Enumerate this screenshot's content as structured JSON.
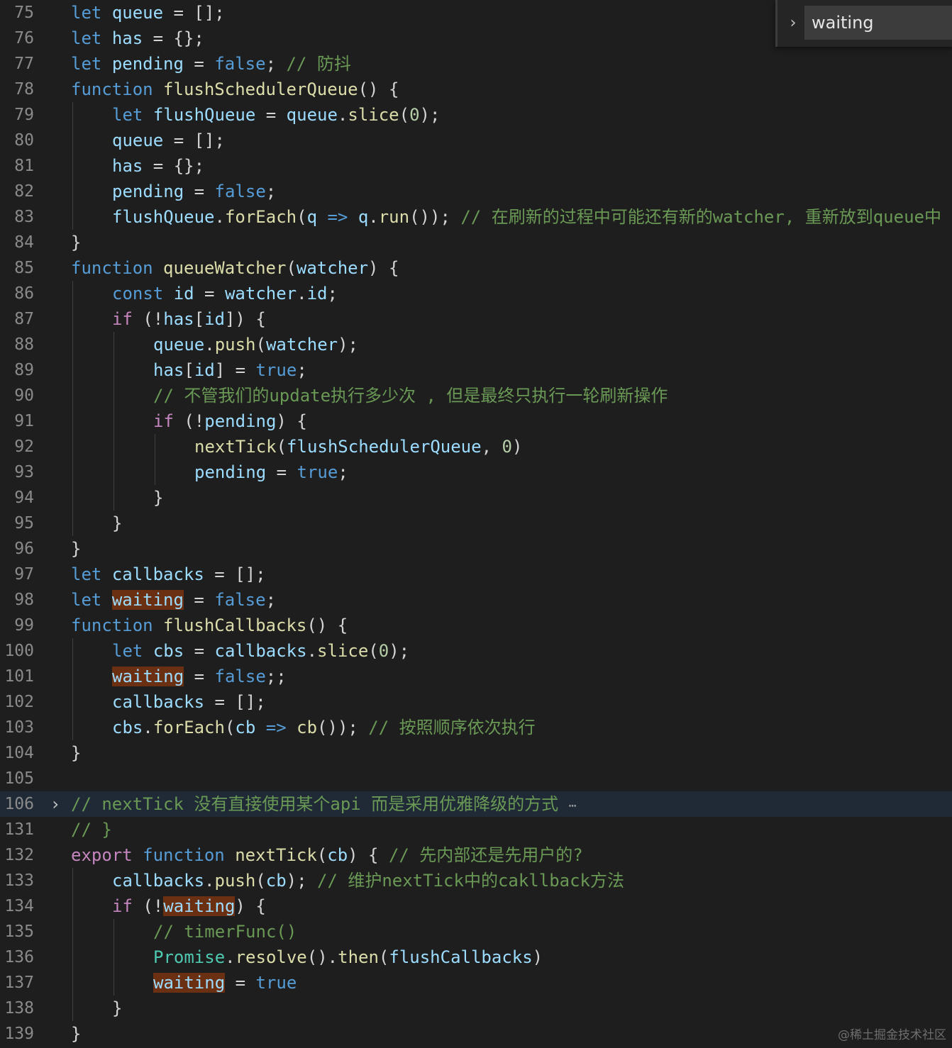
{
  "find_widget": {
    "query": "waiting",
    "toggle_icon": "chevron-right-icon"
  },
  "watermark": "@稀土掘金技术社区",
  "code_lines": [
    {
      "n": "75",
      "indent": 0,
      "tokens": [
        [
          "let",
          "kw"
        ],
        [
          " "
        ],
        [
          "queue",
          "var"
        ],
        [
          " = [];"
        ]
      ]
    },
    {
      "n": "76",
      "indent": 0,
      "tokens": [
        [
          "let",
          "kw"
        ],
        [
          " "
        ],
        [
          "has",
          "var"
        ],
        [
          " = {};"
        ]
      ]
    },
    {
      "n": "77",
      "indent": 0,
      "tokens": [
        [
          "let",
          "kw"
        ],
        [
          " "
        ],
        [
          "pending",
          "var"
        ],
        [
          " = "
        ],
        [
          "false",
          "bool"
        ],
        [
          "; "
        ],
        [
          "// 防抖",
          "cmt"
        ]
      ]
    },
    {
      "n": "78",
      "indent": 0,
      "tokens": [
        [
          "function",
          "kw"
        ],
        [
          " "
        ],
        [
          "flushSchedulerQueue",
          "fn"
        ],
        [
          "() {"
        ]
      ]
    },
    {
      "n": "79",
      "indent": 1,
      "tokens": [
        [
          "let",
          "kw"
        ],
        [
          " "
        ],
        [
          "flushQueue",
          "var"
        ],
        [
          " = "
        ],
        [
          "queue",
          "var"
        ],
        [
          "."
        ],
        [
          "slice",
          "fn"
        ],
        [
          "("
        ],
        [
          "0",
          "num"
        ],
        [
          ");"
        ]
      ]
    },
    {
      "n": "80",
      "indent": 1,
      "tokens": [
        [
          "queue",
          "var"
        ],
        [
          " = [];"
        ]
      ]
    },
    {
      "n": "81",
      "indent": 1,
      "tokens": [
        [
          "has",
          "var"
        ],
        [
          " = {};"
        ]
      ]
    },
    {
      "n": "82",
      "indent": 1,
      "tokens": [
        [
          "pending",
          "var"
        ],
        [
          " = "
        ],
        [
          "false",
          "bool"
        ],
        [
          ";"
        ]
      ]
    },
    {
      "n": "83",
      "indent": 1,
      "tokens": [
        [
          "flushQueue",
          "var"
        ],
        [
          "."
        ],
        [
          "forEach",
          "fn"
        ],
        [
          "("
        ],
        [
          "q",
          "var"
        ],
        [
          " "
        ],
        [
          "=>",
          "kw"
        ],
        [
          " "
        ],
        [
          "q",
          "var"
        ],
        [
          "."
        ],
        [
          "run",
          "fn"
        ],
        [
          "()); "
        ],
        [
          "// 在刷新的过程中可能还有新的watcher, 重新放到queue中",
          "cmt"
        ]
      ]
    },
    {
      "n": "84",
      "indent": 0,
      "tokens": [
        [
          "}"
        ]
      ]
    },
    {
      "n": "85",
      "indent": 0,
      "tokens": [
        [
          "function",
          "kw"
        ],
        [
          " "
        ],
        [
          "queueWatcher",
          "fn"
        ],
        [
          "("
        ],
        [
          "watcher",
          "var"
        ],
        [
          ") {"
        ]
      ]
    },
    {
      "n": "86",
      "indent": 1,
      "tokens": [
        [
          "const",
          "kw"
        ],
        [
          " "
        ],
        [
          "id",
          "var"
        ],
        [
          " = "
        ],
        [
          "watcher",
          "var"
        ],
        [
          "."
        ],
        [
          "id",
          "var"
        ],
        [
          ";"
        ]
      ]
    },
    {
      "n": "87",
      "indent": 1,
      "tokens": [
        [
          "if",
          "ctl"
        ],
        [
          " (!"
        ],
        [
          "has",
          "var"
        ],
        [
          "["
        ],
        [
          "id",
          "var"
        ],
        [
          "]) {"
        ]
      ]
    },
    {
      "n": "88",
      "indent": 2,
      "tokens": [
        [
          "queue",
          "var"
        ],
        [
          "."
        ],
        [
          "push",
          "fn"
        ],
        [
          "("
        ],
        [
          "watcher",
          "var"
        ],
        [
          ");"
        ]
      ]
    },
    {
      "n": "89",
      "indent": 2,
      "tokens": [
        [
          "has",
          "var"
        ],
        [
          "["
        ],
        [
          "id",
          "var"
        ],
        [
          "] = "
        ],
        [
          "true",
          "bool"
        ],
        [
          ";"
        ]
      ]
    },
    {
      "n": "90",
      "indent": 2,
      "tokens": [
        [
          "// 不管我们的update执行多少次 , 但是最终只执行一轮刷新操作",
          "cmt"
        ]
      ]
    },
    {
      "n": "91",
      "indent": 2,
      "tokens": [
        [
          "if",
          "ctl"
        ],
        [
          " (!"
        ],
        [
          "pending",
          "var"
        ],
        [
          ") {"
        ]
      ]
    },
    {
      "n": "92",
      "indent": 3,
      "tokens": [
        [
          "nextTick",
          "fn"
        ],
        [
          "("
        ],
        [
          "flushSchedulerQueue",
          "var"
        ],
        [
          ", "
        ],
        [
          "0",
          "num"
        ],
        [
          ")"
        ]
      ]
    },
    {
      "n": "93",
      "indent": 3,
      "tokens": [
        [
          "pending",
          "var"
        ],
        [
          " = "
        ],
        [
          "true",
          "bool"
        ],
        [
          ";"
        ]
      ]
    },
    {
      "n": "94",
      "indent": 2,
      "tokens": [
        [
          "}"
        ]
      ]
    },
    {
      "n": "95",
      "indent": 1,
      "tokens": [
        [
          "}"
        ]
      ]
    },
    {
      "n": "96",
      "indent": 0,
      "tokens": [
        [
          "}"
        ]
      ]
    },
    {
      "n": "97",
      "indent": 0,
      "tokens": [
        [
          "let",
          "kw"
        ],
        [
          " "
        ],
        [
          "callbacks",
          "var"
        ],
        [
          " = [];"
        ]
      ]
    },
    {
      "n": "98",
      "indent": 0,
      "tokens": [
        [
          "let",
          "kw"
        ],
        [
          " "
        ],
        [
          "waiting",
          "var hl"
        ],
        [
          " = "
        ],
        [
          "false",
          "bool"
        ],
        [
          ";"
        ]
      ]
    },
    {
      "n": "99",
      "indent": 0,
      "tokens": [
        [
          "function",
          "kw"
        ],
        [
          " "
        ],
        [
          "flushCallbacks",
          "fn"
        ],
        [
          "() {"
        ]
      ]
    },
    {
      "n": "100",
      "indent": 1,
      "tokens": [
        [
          "let",
          "kw"
        ],
        [
          " "
        ],
        [
          "cbs",
          "var"
        ],
        [
          " = "
        ],
        [
          "callbacks",
          "var"
        ],
        [
          "."
        ],
        [
          "slice",
          "fn"
        ],
        [
          "("
        ],
        [
          "0",
          "num"
        ],
        [
          ");"
        ]
      ]
    },
    {
      "n": "101",
      "indent": 1,
      "tokens": [
        [
          "waiting",
          "var hl"
        ],
        [
          " = "
        ],
        [
          "false",
          "bool"
        ],
        [
          ";;"
        ]
      ]
    },
    {
      "n": "102",
      "indent": 1,
      "tokens": [
        [
          "callbacks",
          "var"
        ],
        [
          " = [];"
        ]
      ]
    },
    {
      "n": "103",
      "indent": 1,
      "tokens": [
        [
          "cbs",
          "var"
        ],
        [
          "."
        ],
        [
          "forEach",
          "fn"
        ],
        [
          "("
        ],
        [
          "cb",
          "var"
        ],
        [
          " "
        ],
        [
          "=>",
          "kw"
        ],
        [
          " "
        ],
        [
          "cb",
          "fn"
        ],
        [
          "()); "
        ],
        [
          "// 按照顺序依次执行",
          "cmt"
        ]
      ]
    },
    {
      "n": "104",
      "indent": 0,
      "tokens": [
        [
          "}"
        ]
      ]
    },
    {
      "n": "105",
      "indent": 0,
      "tokens": []
    },
    {
      "n": "106",
      "indent": 0,
      "folded": true,
      "tokens": [
        [
          "// nextTick 没有直接使用某个api 而是采用优雅降级的方式 ",
          "cmt"
        ],
        [
          "⋯",
          "ell"
        ]
      ]
    },
    {
      "n": "131",
      "indent": 0,
      "tokens": [
        [
          "// }",
          "cmt"
        ]
      ]
    },
    {
      "n": "132",
      "indent": 0,
      "tokens": [
        [
          "export",
          "ctl"
        ],
        [
          " "
        ],
        [
          "function",
          "kw"
        ],
        [
          " "
        ],
        [
          "nextTick",
          "fn"
        ],
        [
          "("
        ],
        [
          "cb",
          "var"
        ],
        [
          ") { "
        ],
        [
          "// 先内部还是先用户的?",
          "cmt"
        ]
      ]
    },
    {
      "n": "133",
      "indent": 1,
      "tokens": [
        [
          "callbacks",
          "var"
        ],
        [
          "."
        ],
        [
          "push",
          "fn"
        ],
        [
          "("
        ],
        [
          "cb",
          "var"
        ],
        [
          "); "
        ],
        [
          "// 维护nextTick中的cakllback方法",
          "cmt"
        ]
      ]
    },
    {
      "n": "134",
      "indent": 1,
      "tokens": [
        [
          "if",
          "ctl"
        ],
        [
          " (!"
        ],
        [
          "waiting",
          "var hl"
        ],
        [
          ") {"
        ]
      ]
    },
    {
      "n": "135",
      "indent": 2,
      "tokens": [
        [
          "// timerFunc()",
          "cmt"
        ]
      ]
    },
    {
      "n": "136",
      "indent": 2,
      "tokens": [
        [
          "Promise",
          "cls"
        ],
        [
          "."
        ],
        [
          "resolve",
          "fn"
        ],
        [
          "()."
        ],
        [
          "then",
          "fn"
        ],
        [
          "("
        ],
        [
          "flushCallbacks",
          "var"
        ],
        [
          ")"
        ]
      ]
    },
    {
      "n": "137",
      "indent": 2,
      "tokens": [
        [
          "waiting",
          "var hl"
        ],
        [
          " = "
        ],
        [
          "true",
          "bool"
        ]
      ]
    },
    {
      "n": "138",
      "indent": 1,
      "tokens": [
        [
          "}"
        ]
      ]
    },
    {
      "n": "139",
      "indent": 0,
      "tokens": [
        [
          "}"
        ]
      ]
    }
  ]
}
